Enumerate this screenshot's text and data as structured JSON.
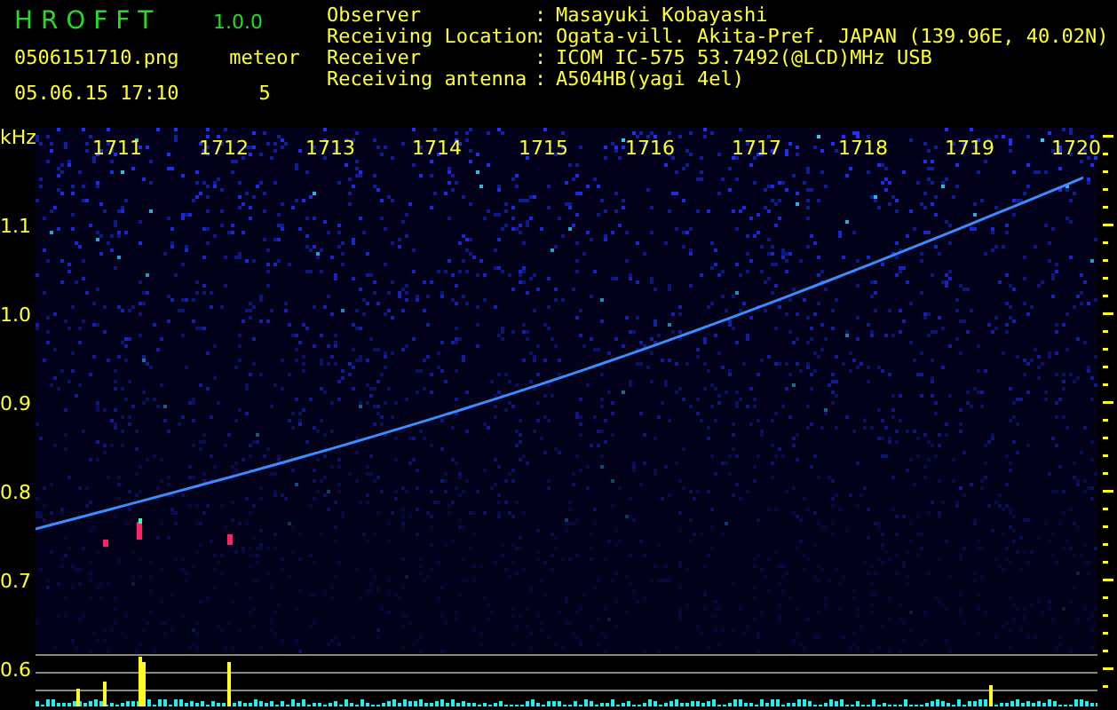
{
  "app": {
    "name": "H R O F F T",
    "version": "1.0.0"
  },
  "file": {
    "name": "0506151710.png",
    "datetime": "05.06.15 17:10"
  },
  "detection": {
    "label": "meteor",
    "count": "5"
  },
  "station": [
    {
      "label": "Observer",
      "separator": ":",
      "value": "Masayuki Kobayashi"
    },
    {
      "label": "Receiving Location",
      "separator": ":",
      "value": "Ogata-vill. Akita-Pref. JAPAN (139.96E, 40.02N)"
    },
    {
      "label": "Receiver",
      "separator": ":",
      "value": "ICOM IC-575 53.7492(@LCD)MHz USB"
    },
    {
      "label": "Receiving antenna",
      "separator": ":",
      "value": "A504HB(yagi 4el)"
    }
  ],
  "spectrogram": {
    "freq_unit": "kHz",
    "freq_labels": [
      "1.1",
      "1.0",
      "0.9",
      "0.8",
      "0.7",
      "0.6"
    ],
    "time_labels": [
      "1711",
      "1712",
      "1713",
      "1714",
      "1715",
      "1716",
      "1717",
      "1718",
      "1719",
      "1720"
    ]
  }
}
